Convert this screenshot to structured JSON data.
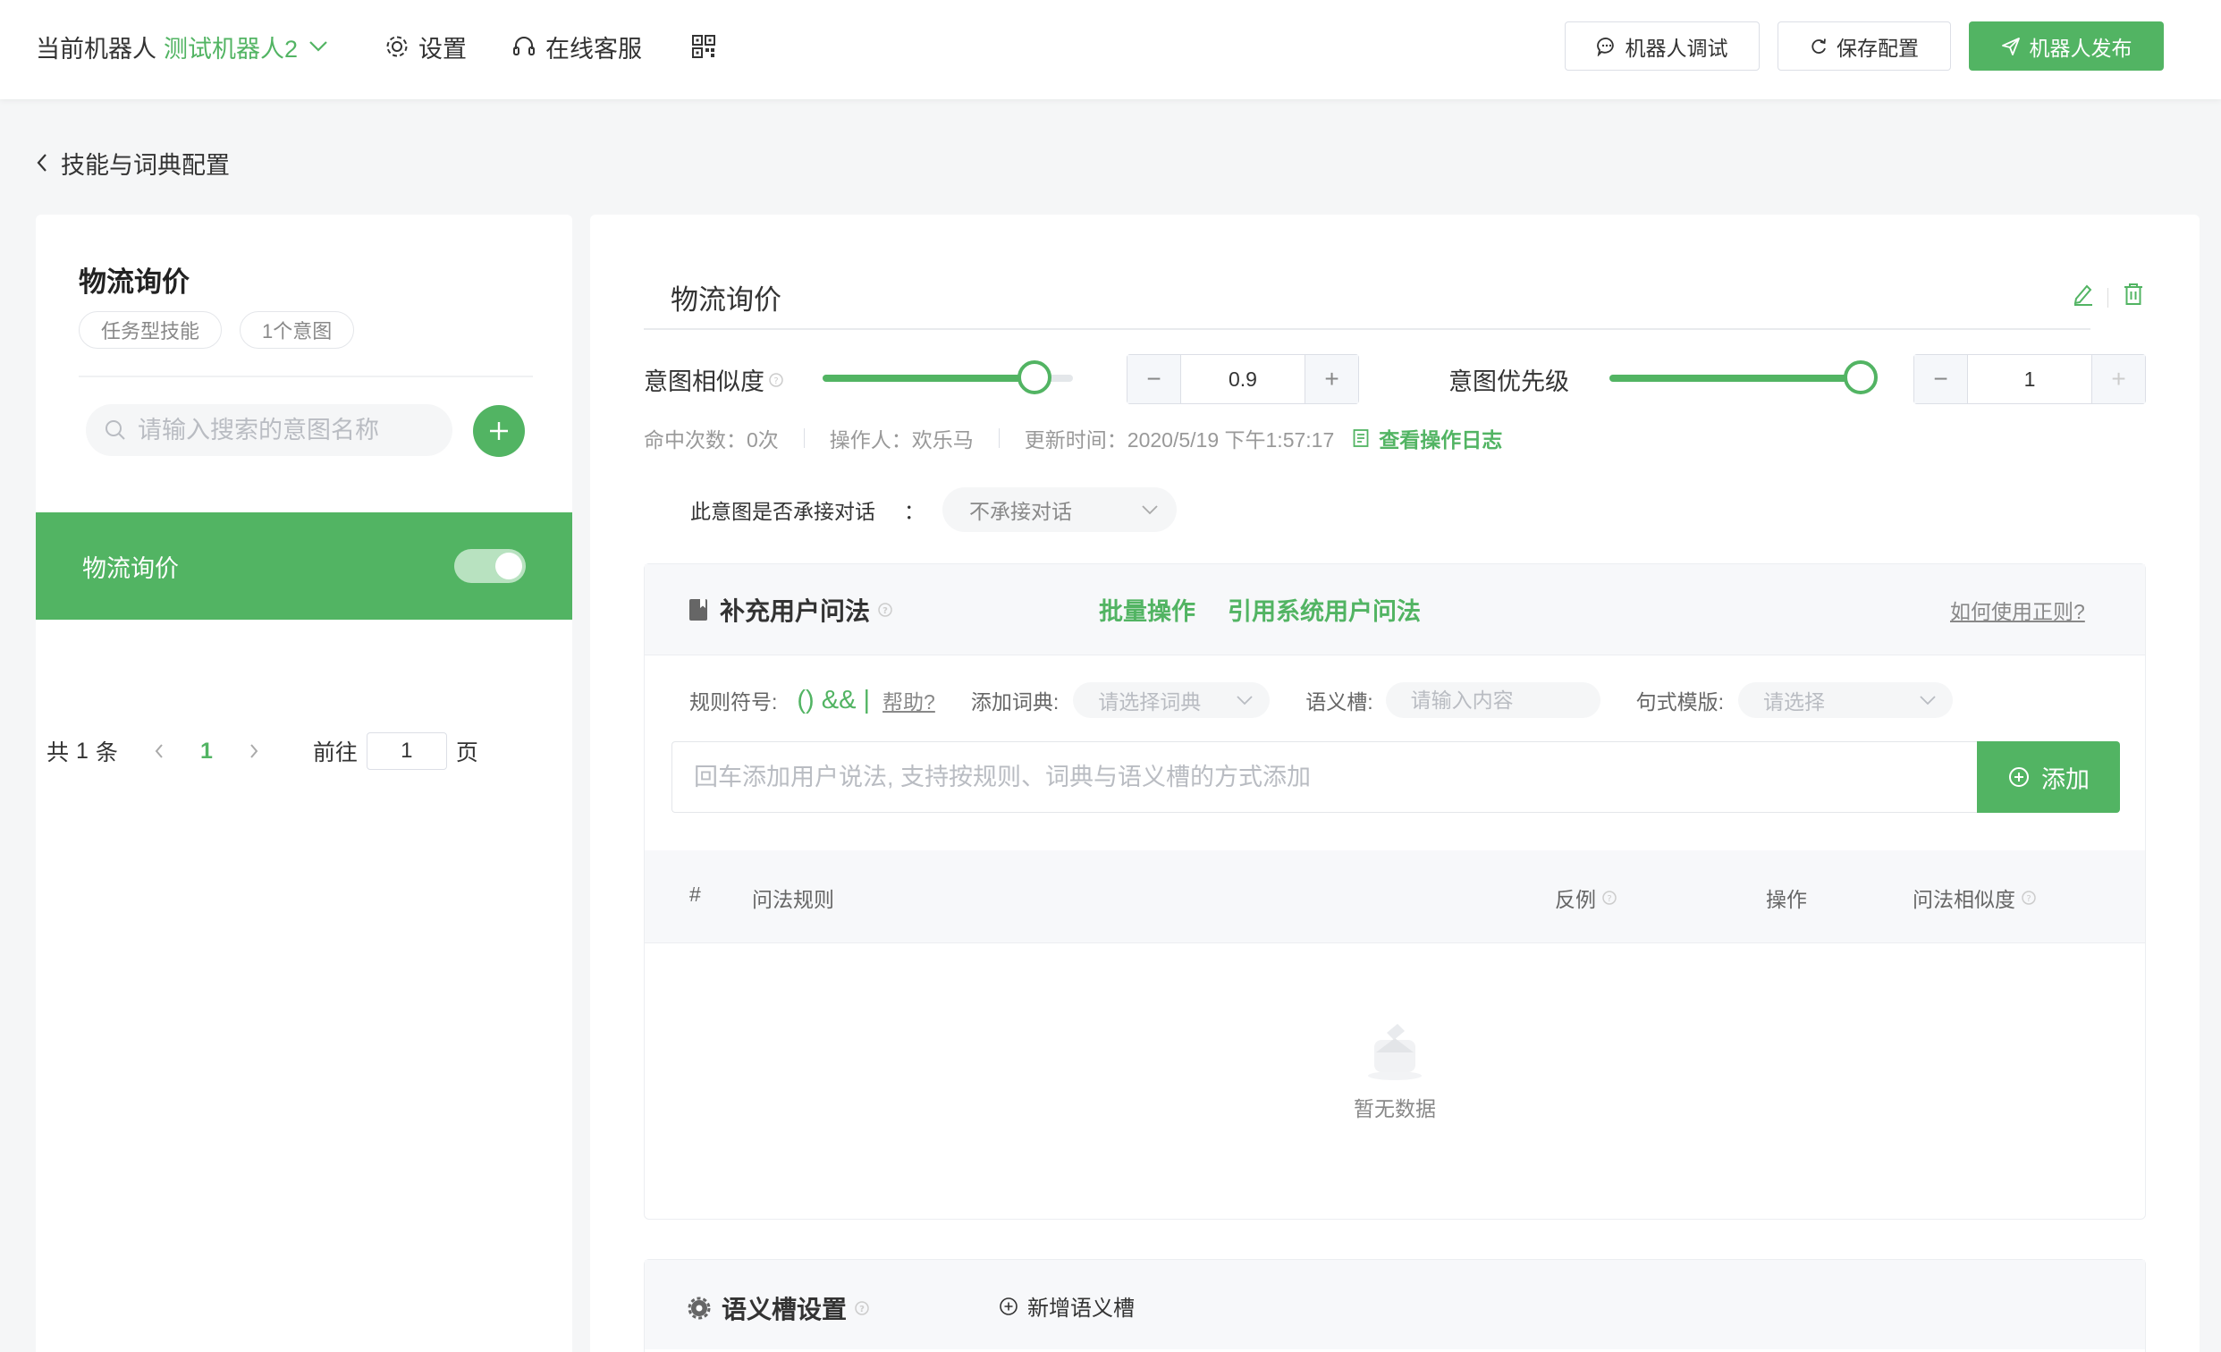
{
  "header": {
    "robot_prefix": "当前机器人",
    "robot_name": "测试机器人2",
    "nav": {
      "settings": "设置",
      "support": "在线客服"
    },
    "buttons": {
      "debug": "机器人调试",
      "save": "保存配置",
      "publish": "机器人发布"
    }
  },
  "breadcrumb": {
    "back_label": "技能与词典配置"
  },
  "sidebar": {
    "skill_name": "物流询价",
    "tags": [
      "任务型技能",
      "1个意图"
    ],
    "search_placeholder": "请输入搜索的意图名称",
    "intents": [
      {
        "label": "物流询价",
        "enabled": true
      }
    ],
    "pagination": {
      "total_prefix": "共",
      "total": "1",
      "total_suffix": "条",
      "current_page": "1",
      "goto_label": "前往",
      "goto_value": "1",
      "page_suffix": "页"
    }
  },
  "intent": {
    "title": "物流询价",
    "similarity": {
      "label": "意图相似度",
      "value": "0.9",
      "fraction": 0.9
    },
    "priority": {
      "label": "意图优先级",
      "value": "1",
      "fraction": 1.0
    },
    "meta": {
      "hits": "命中次数：0次",
      "operator": "操作人：欢乐马",
      "updated": "更新时间：2020/5/19 下午1:57:17",
      "log_link": "查看操作日志"
    },
    "accept": {
      "label": "此意图是否承接对话",
      "colon": "：",
      "value": "不承接对话"
    }
  },
  "supplement": {
    "title": "补充用户问法",
    "batch_link": "批量操作",
    "ref_link": "引用系统用户问法",
    "regex_help": "如何使用正则?",
    "rule_label": "规则符号:",
    "rule_symbols": "() && |",
    "rule_help": "帮助?",
    "dict_label": "添加词典:",
    "dict_placeholder": "请选择词典",
    "slot_label": "语义槽:",
    "slot_placeholder": "请输入内容",
    "template_label": "句式模版:",
    "template_placeholder": "请选择",
    "input_placeholder": "回车添加用户说法, 支持按规则、词典与语义槽的方式添加",
    "add_button": "添加",
    "columns": {
      "index": "#",
      "rule": "问法规则",
      "negative": "反例",
      "action": "操作",
      "similarity": "问法相似度"
    },
    "empty_text": "暂无数据"
  },
  "slots": {
    "title": "语义槽设置",
    "add_link": "新增语义槽"
  },
  "colors": {
    "accent": "#52b463",
    "toggle_on": "#b8e2c0"
  }
}
